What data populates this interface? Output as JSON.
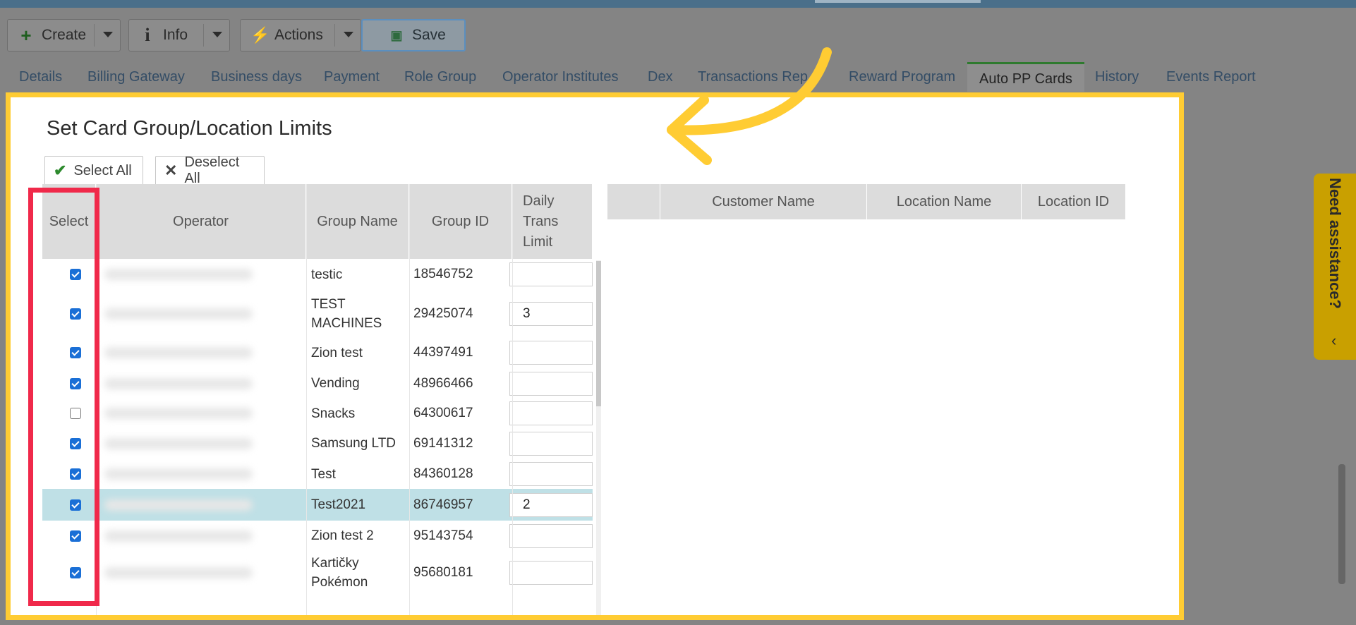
{
  "toolbar": {
    "create_label": "Create",
    "info_label": "Info",
    "actions_label": "Actions",
    "save_label": "Save"
  },
  "tabs": [
    {
      "label": "Details"
    },
    {
      "label": "Billing Gateway"
    },
    {
      "label": "Business days"
    },
    {
      "label": "Payment"
    },
    {
      "label": "Role Group"
    },
    {
      "label": "Operator Institutes"
    },
    {
      "label": "Dex"
    },
    {
      "label": "Transactions Rep"
    },
    {
      "label": "Reward Program"
    },
    {
      "label": "Auto PP Cards"
    },
    {
      "label": "History"
    },
    {
      "label": "Events Report"
    }
  ],
  "dialog": {
    "title": "Set Card Group/Location Limits",
    "select_all_label": "Select All",
    "deselect_all_label": "Deselect All",
    "left_headers": {
      "select": "Select",
      "operator": "Operator",
      "group_name": "Group Name",
      "group_id": "Group ID",
      "daily_limit": "Daily\nTrans\nLimit"
    },
    "right_headers": {
      "customer_name": "Customer Name",
      "location_name": "Location Name",
      "location_id": "Location ID"
    },
    "rows": [
      {
        "checked": true,
        "group_name": "testic",
        "group_id": "18546752",
        "limit": ""
      },
      {
        "checked": true,
        "group_name": "TEST\nMACHINES",
        "group_id": "29425074",
        "limit": "3"
      },
      {
        "checked": true,
        "group_name": "Zion test",
        "group_id": "44397491",
        "limit": ""
      },
      {
        "checked": true,
        "group_name": "Vending",
        "group_id": "48966466",
        "limit": ""
      },
      {
        "checked": false,
        "group_name": "Snacks",
        "group_id": "64300617",
        "limit": ""
      },
      {
        "checked": true,
        "group_name": "Samsung LTD",
        "group_id": "69141312",
        "limit": ""
      },
      {
        "checked": true,
        "group_name": "Test",
        "group_id": "84360128",
        "limit": ""
      },
      {
        "checked": true,
        "group_name": "Test2021",
        "group_id": "86746957",
        "limit": "2",
        "highlighted": true
      },
      {
        "checked": true,
        "group_name": "Zion test 2",
        "group_id": "95143754",
        "limit": ""
      },
      {
        "checked": true,
        "group_name": "Kartičky\nPokémon",
        "group_id": "95680181",
        "limit": ""
      }
    ]
  },
  "help": {
    "label": "Need assistance?"
  },
  "colors": {
    "highlight_frame": "#ffcc33",
    "annotation_red": "#f0294a",
    "checkbox_blue": "#1a6fd6",
    "active_tab_green": "#2e7a2e"
  }
}
